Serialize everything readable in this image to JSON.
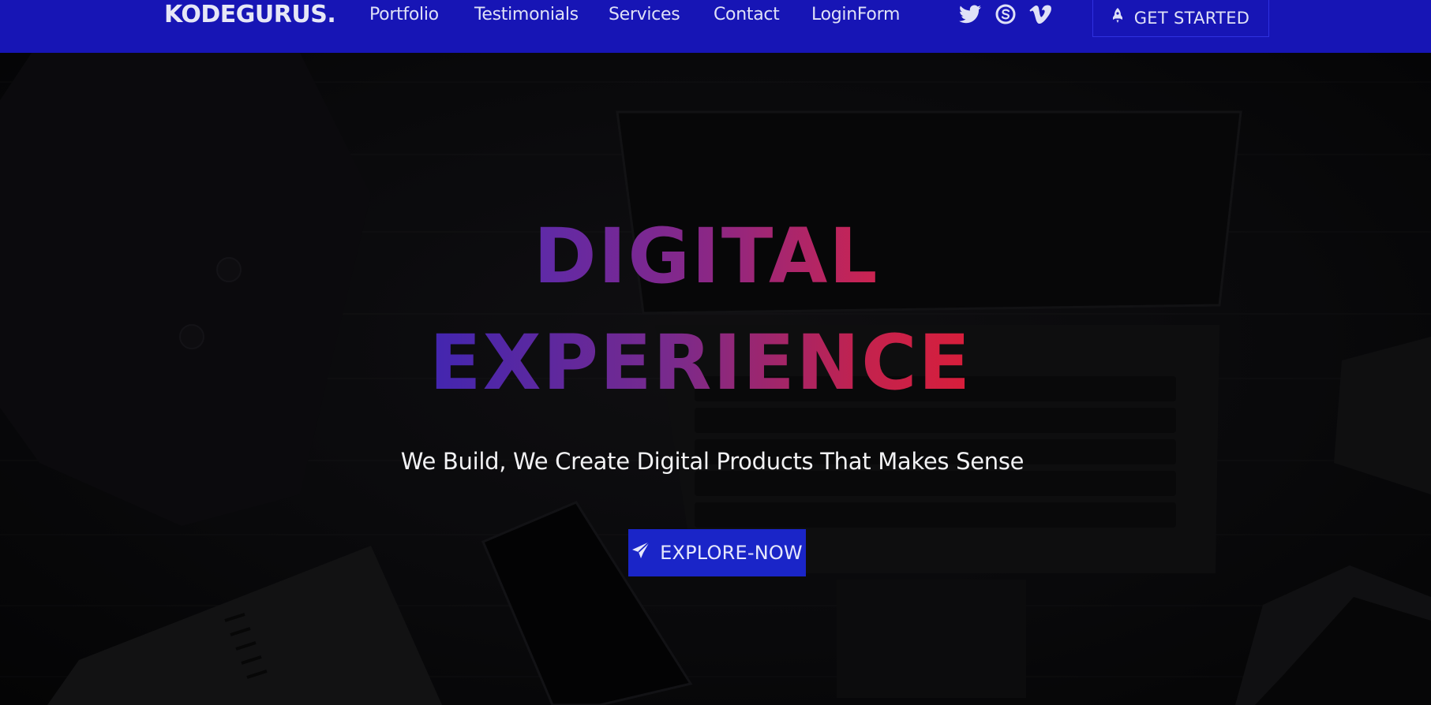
{
  "brand": {
    "name": "KODEGURUS."
  },
  "nav": {
    "links": [
      {
        "label": "Portfolio"
      },
      {
        "label": "Testimonials"
      },
      {
        "label": "Services"
      },
      {
        "label": "Contact"
      },
      {
        "label": "LoginForm"
      }
    ],
    "social_icons": [
      "twitter-icon",
      "skype-icon",
      "vimeo-icon"
    ],
    "cta": {
      "label": "GET STARTED",
      "icon": "rocket-icon"
    }
  },
  "hero": {
    "title_line1": "DIGITAL",
    "title_line2": "EXPERIENCE",
    "subtitle": "We Build, We Create Digital Products That Makes Sense",
    "button": {
      "label": "EXPLORE-NOW",
      "icon": "paper-plane-icon"
    }
  },
  "colors": {
    "nav_background": "#1715b5",
    "button_background": "#1a25c8",
    "title_gradient_start": "#4226b0",
    "title_gradient_end": "#d81e3a"
  }
}
